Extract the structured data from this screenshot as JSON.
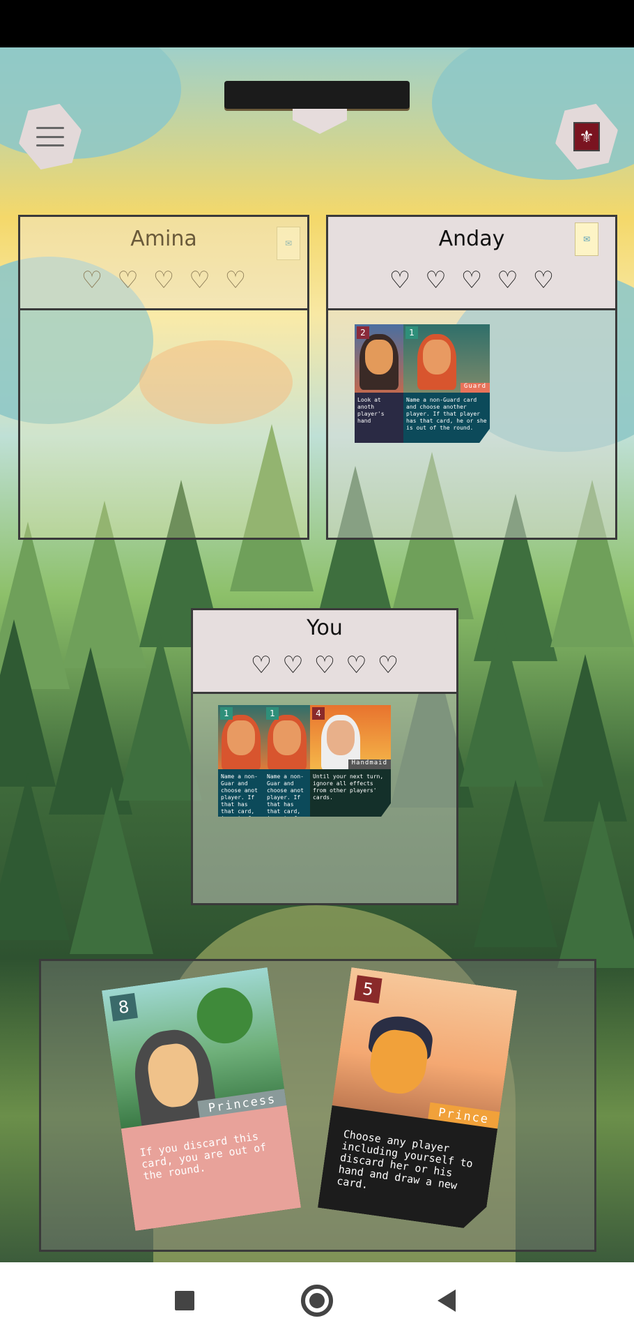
{
  "players": {
    "amina": {
      "name": "Amina",
      "hearts": 5
    },
    "anday": {
      "name": "Anday",
      "hearts": 5
    },
    "you": {
      "name": "You",
      "hearts": 5
    }
  },
  "anday_played": [
    {
      "number": "2",
      "text": "Look at anoth player's hand"
    },
    {
      "number": "1",
      "tag": "Guard",
      "text": "Name a non-Guard card and choose another player. If that player has that card, he or she is out of the round."
    }
  ],
  "you_played": [
    {
      "number": "1",
      "text": "Name a non-Guar and choose anot player. If that has that card, is out of the r"
    },
    {
      "number": "1",
      "text": "Name a non-Guar and choose anot player. If that has that card, is out of the r"
    },
    {
      "number": "4",
      "tag": "Handmaid",
      "text": "Until your next turn, ignore all effects from other players' cards."
    }
  ],
  "hand": [
    {
      "number": "8",
      "tag": "Princess",
      "text": "If you discard this card, you are out of the round.",
      "color": "#e8a29a"
    },
    {
      "number": "5",
      "tag": "Prince",
      "text": "Choose any player including yourself to discard her or his hand and draw a new card.",
      "color": "#1c1c1c"
    }
  ],
  "icons": {
    "menu": "hamburger-icon",
    "deck": "fleur-de-lis-icon",
    "heart": "heart-outline-icon",
    "token": "letter-token-icon"
  },
  "glyphs": {
    "heart": "♡",
    "fleur": "⚜",
    "token": "✉"
  },
  "colors": {
    "panel_head": "#e6dede",
    "panel_border": "#3a3a3a",
    "hand_area": "#787878"
  }
}
